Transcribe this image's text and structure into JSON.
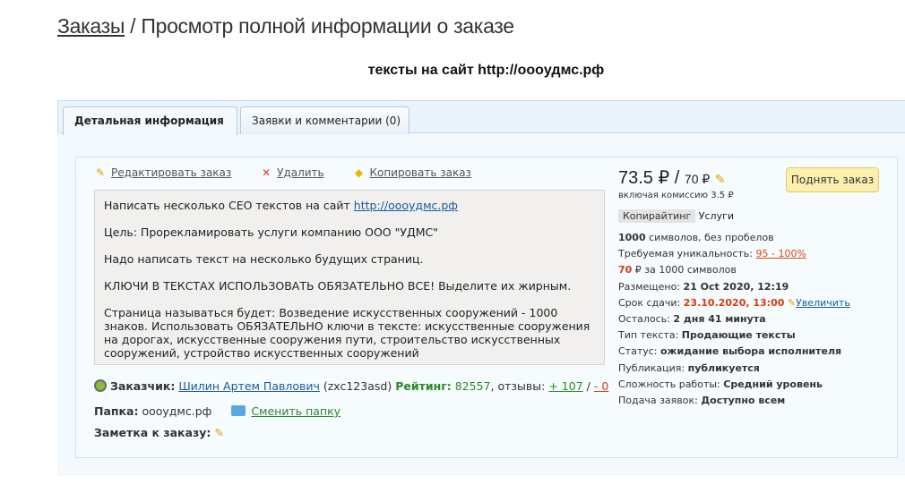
{
  "breadcrumb": {
    "parent": "Заказы",
    "separator": " / ",
    "current": "Просмотр полной информации о заказе"
  },
  "order_title": "тексты на сайт http://oooудмс.рф",
  "tabs": [
    {
      "label": "Детальная информация",
      "active": true
    },
    {
      "label": "Заявки и комментарии (0)",
      "active": false
    }
  ],
  "actions": {
    "edit": "Редактировать заказ",
    "delete": "Удалить",
    "copy": "Копировать заказ"
  },
  "description": {
    "line1_text": "Написать несколько СЕО текстов на сайт ",
    "line1_link": "http://oooудмс.рф",
    "line2": "Цель: Прорекламировать услуги компанию ООО \"УДМС\"",
    "line3": "Надо написать текст на несколько будущих страниц.",
    "line4": "КЛЮЧИ В ТЕКСТАХ ИСПОЛЬЗОВАТЬ ОБЯЗАТЕЛЬНО ВСЕ! Выделите их жирным.",
    "line5": "Страница называться будет: Возведение искусственных сооружений - 1000 знаков. Использовать ОБЯЗАТЕЛЬНО ключи в тексте: искусственные сооружения на дорогах, искусственные сооружения пути, строительство искусственных сооружений, устройство искусственных сооружений"
  },
  "customer": {
    "label": "Заказчик:",
    "name": "Шилин Артем Павлович",
    "login": "(zxc123asd)",
    "rating_label": "Рейтинг:",
    "rating": "82557",
    "reviews_label": ", отзывы:",
    "reviews_pos": "+ 107",
    "reviews_sep": "/",
    "reviews_neg": "- 0"
  },
  "folder": {
    "label": "Папка:",
    "value": "oooудмс.рф",
    "change": "Сменить папку"
  },
  "note": {
    "label": "Заметка к заказу:"
  },
  "price": {
    "main": "73.5 ₽",
    "separator": "/",
    "old": "70 ₽",
    "commission": "включая комиссию 3.5 ₽"
  },
  "raise_button": "Поднять заказ",
  "tags": {
    "category": "Копирайтинг",
    "subcategory": "Услуги"
  },
  "info": {
    "symbols_value": "1000",
    "symbols_text": " символов, без пробелов",
    "uniq_label": "Требуемая уникальность: ",
    "uniq_value": "95 - 100%",
    "per_value": "70",
    "per_text": " ₽ за 1000 символов",
    "posted_label": "Размещено: ",
    "posted_value": "21 Oct 2020, 12:19",
    "deadline_label": "Срок сдачи: ",
    "deadline_value": "23.10.2020, 13:00",
    "increase": "Увеличить",
    "left_label": "Осталось: ",
    "left_value": "2 дня 41 минута",
    "type_label": "Тип текста: ",
    "type_value": "Продающие тексты",
    "status_label": "Статус: ",
    "status_value": "ожидание выбора исполнителя",
    "pub_label": "Публикация: ",
    "pub_value": "публикуется",
    "diff_label": "Сложность работы: ",
    "diff_value": "Средний уровень",
    "apply_label": "Подача заявок: ",
    "apply_value": "Доступно всем"
  }
}
